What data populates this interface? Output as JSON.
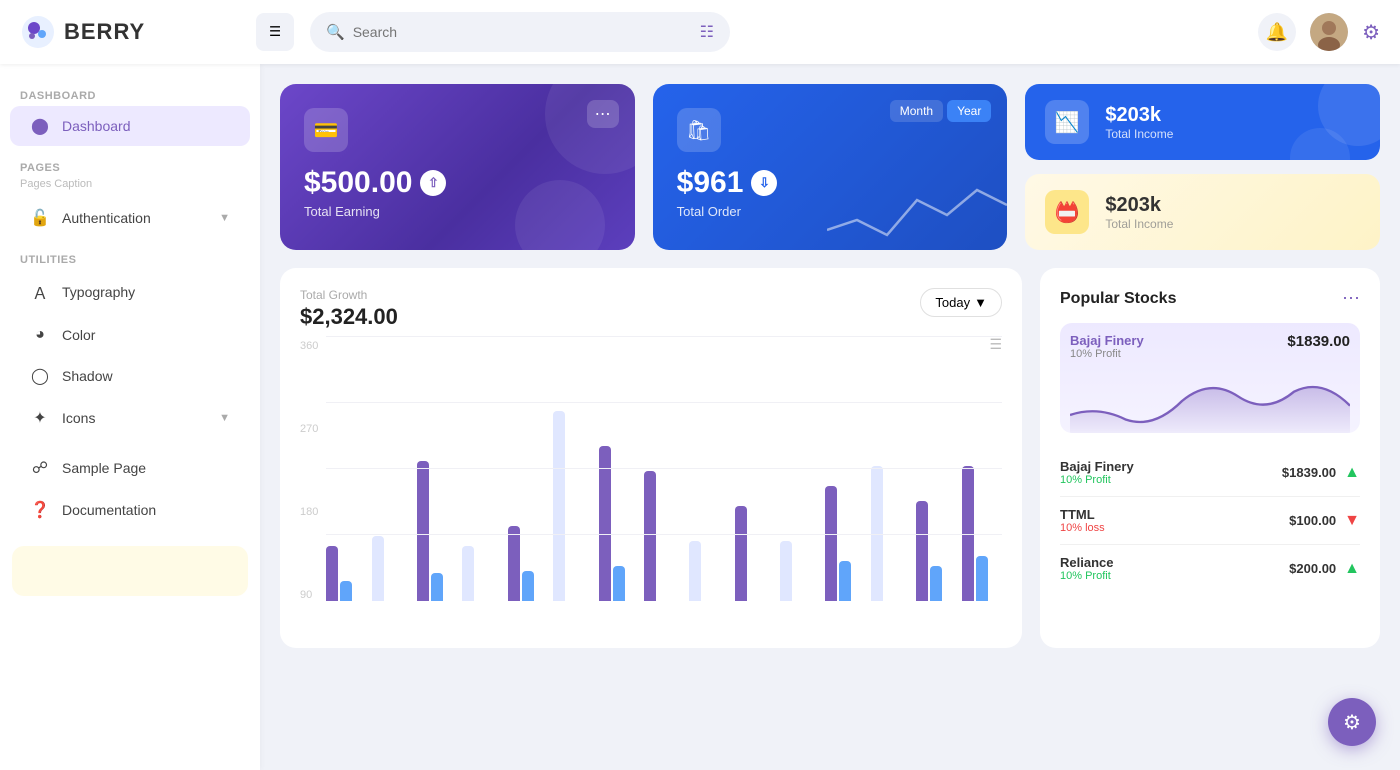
{
  "app": {
    "name": "BERRY",
    "logo_emoji": "🫐"
  },
  "header": {
    "search_placeholder": "Search",
    "hamburger_label": "≡",
    "filter_icon": "⊞",
    "notif_icon": "🔔",
    "settings_icon": "⚙"
  },
  "sidebar": {
    "dashboard_section": "Dashboard",
    "dashboard_item": "Dashboard",
    "pages_section": "Pages",
    "pages_caption": "Pages Caption",
    "auth_item": "Authentication",
    "utilities_section": "Utilities",
    "typography_item": "Typography",
    "color_item": "Color",
    "shadow_item": "Shadow",
    "icons_item": "Icons",
    "sample_page_item": "Sample Page",
    "documentation_item": "Documentation"
  },
  "cards": {
    "earning": {
      "amount": "$500.00",
      "label": "Total Earning"
    },
    "order": {
      "amount": "$961",
      "label": "Total Order",
      "tab_month": "Month",
      "tab_year": "Year"
    },
    "income1": {
      "amount": "$203k",
      "label": "Total Income"
    },
    "income2": {
      "amount": "$203k",
      "label": "Total Income"
    }
  },
  "chart": {
    "title": "Total Growth",
    "amount": "$2,324.00",
    "period_btn": "Today",
    "y_labels": [
      "360",
      "270",
      "180",
      "90"
    ],
    "bars": [
      {
        "purple": 55,
        "blue": 18,
        "light": 0
      },
      {
        "purple": 0,
        "blue": 0,
        "light": 65
      },
      {
        "purple": 140,
        "blue": 28,
        "light": 0
      },
      {
        "purple": 0,
        "blue": 0,
        "light": 55
      },
      {
        "purple": 75,
        "blue": 30,
        "light": 0
      },
      {
        "purple": 0,
        "blue": 0,
        "light": 190
      },
      {
        "purple": 155,
        "blue": 35,
        "light": 0
      },
      {
        "purple": 130,
        "blue": 0,
        "light": 0
      },
      {
        "purple": 0,
        "blue": 0,
        "light": 60
      },
      {
        "purple": 95,
        "blue": 0,
        "light": 0
      },
      {
        "purple": 0,
        "blue": 0,
        "light": 60
      },
      {
        "purple": 115,
        "blue": 40,
        "light": 0
      },
      {
        "purple": 0,
        "blue": 0,
        "light": 135
      },
      {
        "purple": 100,
        "blue": 35,
        "light": 0
      },
      {
        "purple": 135,
        "blue": 45,
        "light": 0
      }
    ]
  },
  "stocks": {
    "title": "Popular Stocks",
    "featured": {
      "name": "Bajaj Finery",
      "price": "$1839.00",
      "profit": "10% Profit"
    },
    "rows": [
      {
        "name": "Bajaj Finery",
        "sub": "10% Profit",
        "sub_type": "profit",
        "price": "$1839.00",
        "trend": "up"
      },
      {
        "name": "TTML",
        "sub": "10% loss",
        "sub_type": "loss",
        "price": "$100.00",
        "trend": "down"
      },
      {
        "name": "Reliance",
        "sub": "10% Profit",
        "sub_type": "profit",
        "price": "$200.00",
        "trend": "up"
      }
    ]
  }
}
